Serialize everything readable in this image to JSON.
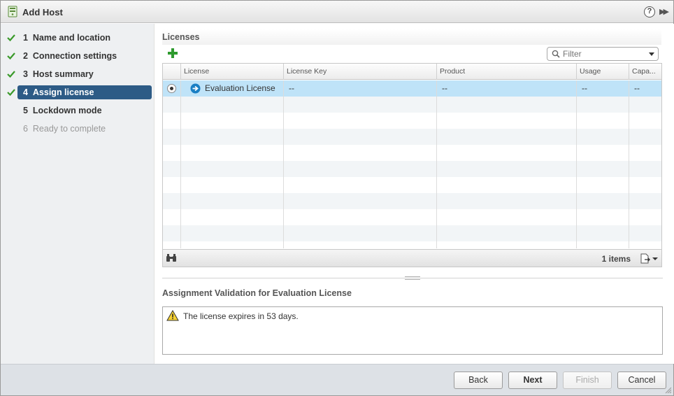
{
  "window": {
    "title": "Add Host"
  },
  "steps": [
    {
      "number": "1",
      "label": "Name and location",
      "state": "completed"
    },
    {
      "number": "2",
      "label": "Connection settings",
      "state": "completed"
    },
    {
      "number": "3",
      "label": "Host summary",
      "state": "completed"
    },
    {
      "number": "4",
      "label": "Assign license",
      "state": "active"
    },
    {
      "number": "5",
      "label": "Lockdown mode",
      "state": "pending"
    },
    {
      "number": "6",
      "label": "Ready to complete",
      "state": "disabled"
    }
  ],
  "licenses": {
    "title": "Licenses",
    "filter_placeholder": "Filter",
    "columns": [
      "License",
      "License Key",
      "Product",
      "Usage",
      "Capa..."
    ],
    "rows": [
      {
        "license": "Evaluation License",
        "key": "--",
        "product": "--",
        "usage": "--",
        "capacity": "--",
        "selected": true
      }
    ],
    "items_count": "1 items"
  },
  "validation": {
    "title": "Assignment Validation for Evaluation License",
    "message": "The license expires in 53 days."
  },
  "buttons": {
    "back": "Back",
    "next": "Next",
    "finish": "Finish",
    "cancel": "Cancel"
  },
  "colors": {
    "active_step": "#2d5b86",
    "selected_row": "#bfe3f8",
    "check": "#3a9a2a"
  },
  "icons": [
    "host-icon",
    "help-icon",
    "expand-icon",
    "check-icon",
    "add-icon",
    "search-icon",
    "arrow-right-circle-icon",
    "binoculars-icon",
    "export-icon",
    "warning-icon"
  ]
}
